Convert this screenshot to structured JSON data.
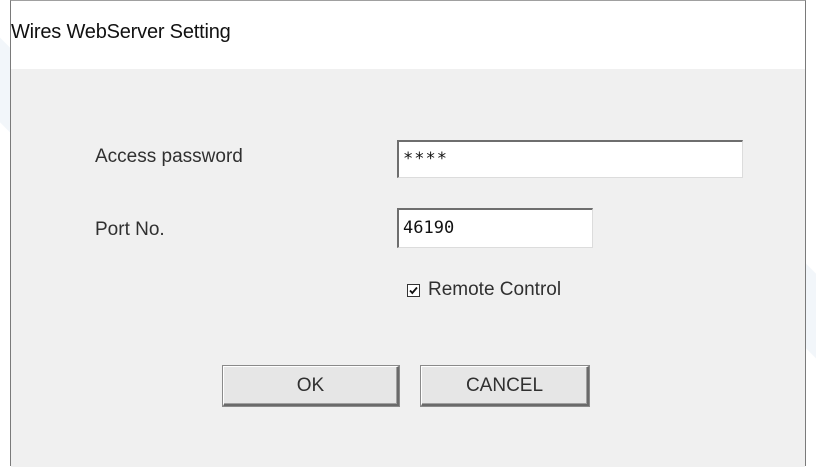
{
  "window": {
    "title": "Wires WebServer Setting"
  },
  "form": {
    "password_label": "Access password",
    "password_value": "****",
    "port_label": "Port No.",
    "port_value": "46190",
    "remote_control_label": "Remote Control",
    "remote_control_checked": true
  },
  "buttons": {
    "ok_label": "OK",
    "cancel_label": "CANCEL"
  },
  "colors": {
    "dialog_background": "#f0f0f0",
    "titlebar_background": "#ffffff",
    "text": "#303030"
  }
}
